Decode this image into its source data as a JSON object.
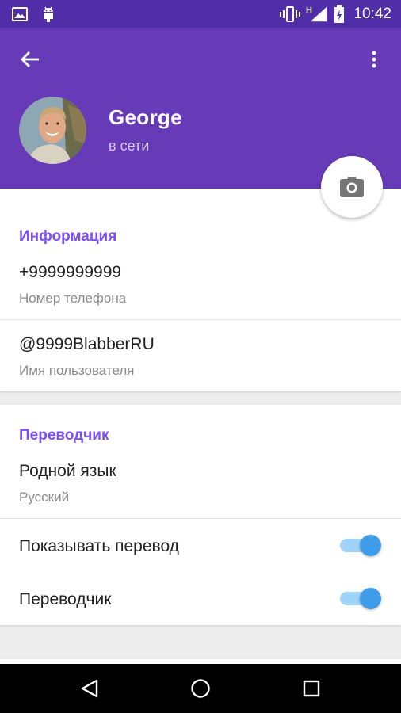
{
  "status_bar": {
    "time": "10:42",
    "network_type": "H",
    "icons": [
      "gallery-icon",
      "android-icon",
      "vibrate-icon",
      "signal-icon",
      "battery-charging-icon"
    ]
  },
  "header": {
    "back_icon": "arrow-back-icon",
    "menu_icon": "more-vert-icon",
    "name": "George",
    "status": "в сети",
    "camera_icon": "camera-icon"
  },
  "info": {
    "title": "Информация",
    "phone": {
      "value": "+9999999999",
      "label": "Номер телефона"
    },
    "username": {
      "value": "@9999BlabberRU",
      "label": "Имя пользователя"
    }
  },
  "translator": {
    "title": "Переводчик",
    "native_language": {
      "label": "Родной язык",
      "value": "Русский"
    },
    "show_translation": {
      "label": "Показывать перевод",
      "enabled": true
    },
    "translator_toggle": {
      "label": "Переводчик",
      "enabled": true
    }
  },
  "colors": {
    "status_bar": "#512da8",
    "header": "#673ab7",
    "section_title": "#7c4dff",
    "toggle_on": "#3f9ce8"
  },
  "nav_bar": {
    "icons": [
      "back-triangle-icon",
      "home-circle-icon",
      "recents-square-icon"
    ]
  }
}
